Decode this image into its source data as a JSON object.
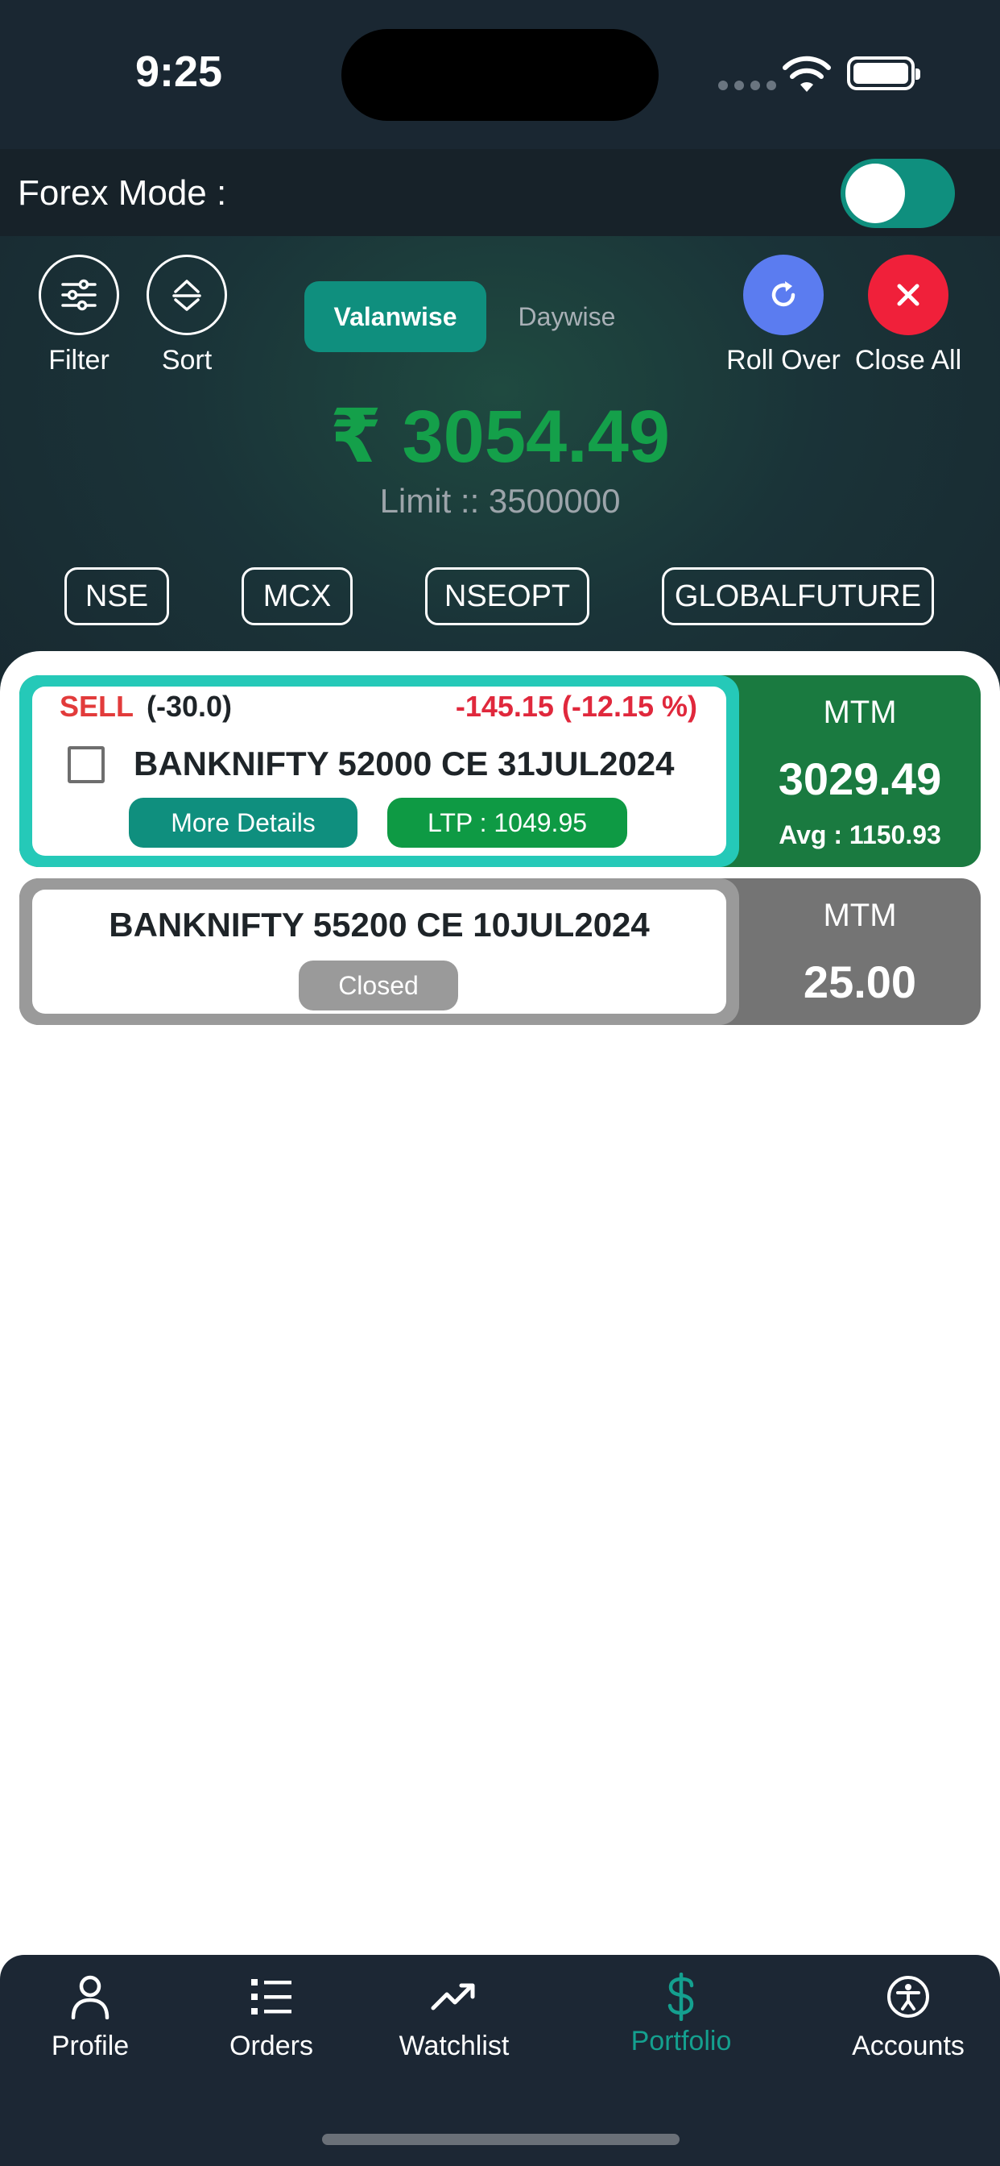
{
  "status": {
    "time": "9:25"
  },
  "forex": {
    "label": "Forex Mode :",
    "enabled": true
  },
  "toolbar": {
    "filter_label": "Filter",
    "sort_label": "Sort",
    "rollover_label": "Roll Over",
    "closeall_label": "Close All"
  },
  "segment": {
    "active": "Valanwise",
    "inactive": "Daywise"
  },
  "summary": {
    "amount": "₹ 3054.49",
    "limit": "Limit :: 3500000"
  },
  "exchanges": [
    "NSE",
    "MCX",
    "NSEOPT",
    "GLOBALFUTURE"
  ],
  "positions": [
    {
      "side": "SELL",
      "qty": "(-30.0)",
      "pnl": "-145.15 (-12.15 %)",
      "symbol": "BANKNIFTY 52000 CE 31JUL2024",
      "details_label": "More Details",
      "ltp": "LTP : 1049.95",
      "mtm_label": "MTM",
      "mtm_value": "3029.49",
      "avg": "Avg : 1150.93"
    },
    {
      "symbol": "BANKNIFTY 55200 CE 10JUL2024",
      "status": "Closed",
      "mtm_label": "MTM",
      "mtm_value": "25.00"
    }
  ],
  "nav": [
    {
      "label": "Profile",
      "icon": "person-icon"
    },
    {
      "label": "Orders",
      "icon": "list-icon"
    },
    {
      "label": "Watchlist",
      "icon": "trending-up-icon"
    },
    {
      "label": "Portfolio",
      "icon": "dollar-icon",
      "active": true
    },
    {
      "label": "Accounts",
      "icon": "accessibility-icon"
    }
  ],
  "colors": {
    "accent": "#0f8f7e",
    "profit": "#14a04a",
    "loss": "#e0283c",
    "rollover": "#5b7cf0",
    "closeall": "#f0203a",
    "active_nav": "#14a08f"
  }
}
